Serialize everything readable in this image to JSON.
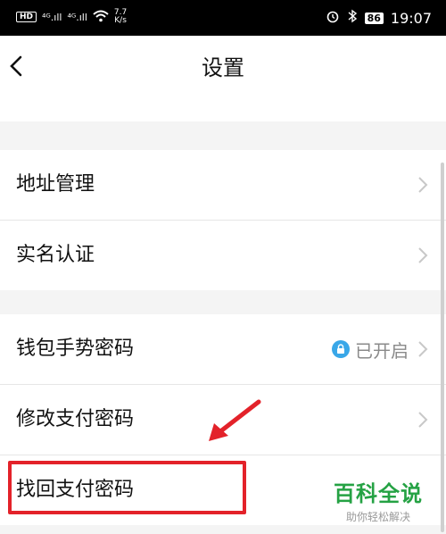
{
  "status_bar": {
    "hd_badge": "HD",
    "signal_1": "⁴ᴳ.ıll",
    "signal_2": "⁴ᴳ.ıll",
    "net_speed_value": "7.7",
    "net_speed_unit": "K/s",
    "battery": "86",
    "time": "19:07"
  },
  "header": {
    "title": "设置"
  },
  "settings": [
    {
      "label": "地址管理"
    },
    {
      "label": "实名认证"
    },
    {
      "label": "钱包手势密码",
      "status": "已开启"
    },
    {
      "label": "修改支付密码"
    },
    {
      "label": "找回支付密码"
    }
  ],
  "watermark": {
    "title": "百科全说",
    "subtitle": "助你轻松解决"
  },
  "colors": {
    "highlight": "#e3222a",
    "status_icon": "#39a7e8",
    "watermark": "#25a244"
  }
}
